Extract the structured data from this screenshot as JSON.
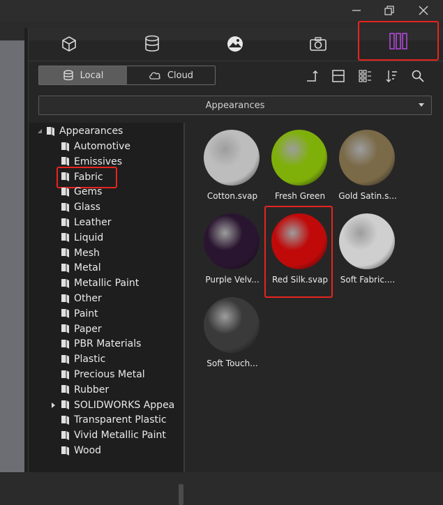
{
  "window": {
    "controls": [
      "minimize-icon",
      "restore-icon",
      "close-icon"
    ]
  },
  "tabs": [
    {
      "icon": "cube-icon"
    },
    {
      "icon": "database-icon"
    },
    {
      "icon": "scene-icon"
    },
    {
      "icon": "camera-icon"
    },
    {
      "icon": "library-columns-icon",
      "active": true
    }
  ],
  "source_toggle": {
    "local": "Local",
    "cloud": "Cloud",
    "selected": "Local"
  },
  "toolbar": [
    "up-level-icon",
    "view-toggle-icon",
    "grid-view-icon",
    "sort-icon",
    "search-icon"
  ],
  "dropdown": {
    "value": "Appearances"
  },
  "tree": {
    "root": "Appearances",
    "items": [
      "Automotive",
      "Emissives",
      "Fabric",
      "Gems",
      "Glass",
      "Leather",
      "Liquid",
      "Mesh",
      "Metal",
      "Metallic Paint",
      "Other",
      "Paint",
      "Paper",
      "PBR Materials",
      "Plastic",
      "Precious Metal",
      "Rubber",
      "SOLIDWORKS Appea",
      "Transparent Plastic",
      "Vivid Metallic Paint",
      "Wood"
    ],
    "selected": "Fabric"
  },
  "materials": [
    {
      "label": "Cotton.svap",
      "color": "#bdbdbd"
    },
    {
      "label": "Fresh Green",
      "color": "#7fb00a"
    },
    {
      "label": "Gold Satin.s...",
      "color": "#7a6a48"
    },
    {
      "label": "Purple Velv...",
      "color": "#2a1530"
    },
    {
      "label": "Red Silk.svap",
      "color": "#c00a0a",
      "selected": true
    },
    {
      "label": "Soft Fabric....",
      "color": "#cfcfcf"
    },
    {
      "label": "Soft Touch...",
      "color": "#3a3a3a"
    }
  ],
  "colors": {
    "accent": "#e8241e",
    "active_tab_icon": "#b04ad8"
  }
}
